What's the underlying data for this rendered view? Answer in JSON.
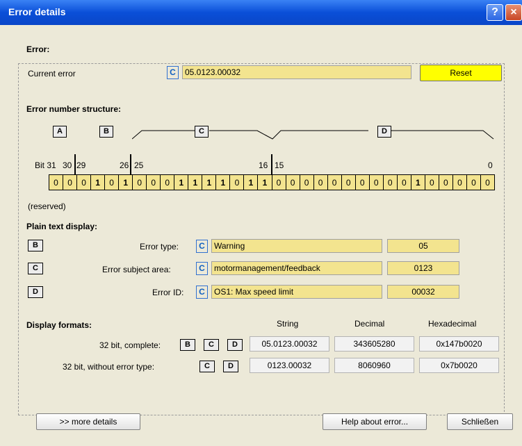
{
  "window": {
    "title": "Error details"
  },
  "error": {
    "heading": "Error:",
    "current_label": "Current error",
    "current_value": "05.0123.00032",
    "reset": "Reset",
    "c_tag": "C"
  },
  "structure": {
    "heading": "Error number structure:",
    "tags": [
      "A",
      "B",
      "C",
      "D"
    ],
    "bit_labels": {
      "bit31": "Bit 31",
      "bit30": "30",
      "bit29": "29",
      "bit26": "26",
      "bit25": "25",
      "bit16": "16",
      "bit15": "15",
      "bit0": "0"
    },
    "reserved": "(reserved)",
    "bits": [
      0,
      0,
      0,
      1,
      0,
      1,
      0,
      0,
      0,
      1,
      1,
      1,
      1,
      0,
      1,
      1,
      0,
      0,
      0,
      0,
      0,
      0,
      0,
      0,
      0,
      0,
      1,
      0,
      0,
      0,
      0,
      0
    ]
  },
  "plain": {
    "heading": "Plain text display:",
    "rows": [
      {
        "tag": "B",
        "label": "Error type:",
        "text": "Warning",
        "code": "05"
      },
      {
        "tag": "C",
        "label": "Error subject area:",
        "text": "motormanagement/feedback",
        "code": "0123"
      },
      {
        "tag": "D",
        "label": "Error ID:",
        "text": "OS1: Max speed limit",
        "code": "00032"
      }
    ]
  },
  "formats": {
    "heading": "Display formats:",
    "columns": [
      "String",
      "Decimal",
      "Hexadecimal"
    ],
    "rows": [
      {
        "label": "32 bit, complete:",
        "tags": [
          "B",
          "C",
          "D"
        ],
        "string": "05.0123.00032",
        "decimal": "343605280",
        "hex": "0x147b0020"
      },
      {
        "label": "32 bit, without error type:",
        "tags": [
          "C",
          "D"
        ],
        "string": "0123.00032",
        "decimal": "8060960",
        "hex": "0x7b0020"
      }
    ]
  },
  "buttons": {
    "more": ">> more details",
    "help": "Help about error...",
    "close": "Schließen"
  }
}
